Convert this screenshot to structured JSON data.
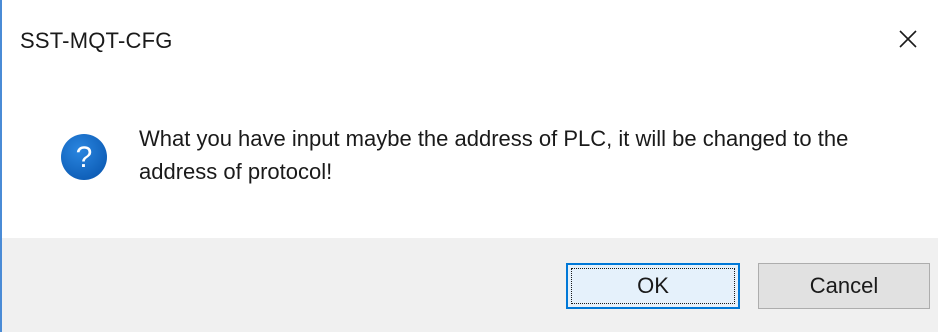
{
  "dialog": {
    "title": "SST-MQT-CFG",
    "message": "What you have input maybe the address of PLC, it will be changed to the address of protocol!",
    "icon": "question-icon",
    "buttons": {
      "ok_label": "OK",
      "cancel_label": "Cancel"
    }
  },
  "colors": {
    "accent": "#0078d7",
    "icon_blue": "#1565c0",
    "footer_bg": "#f0f0f0",
    "button_bg": "#e1e1e1"
  }
}
